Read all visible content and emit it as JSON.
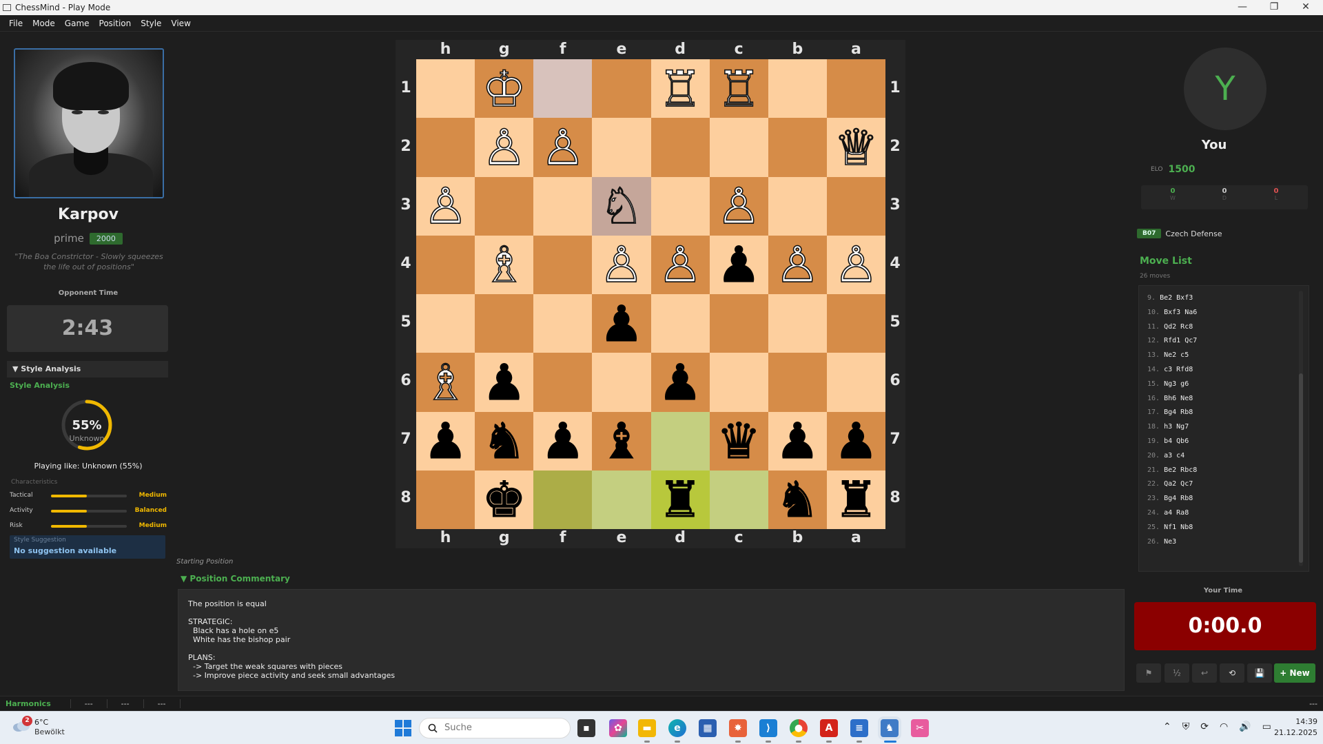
{
  "window": {
    "title": "ChessMind - Play Mode"
  },
  "menu": [
    "File",
    "Mode",
    "Game",
    "Position",
    "Style",
    "View"
  ],
  "opponent": {
    "name": "Karpov",
    "style": "prime",
    "elo": "2000",
    "quote": "\"The Boa Constrictor - Slowly squeezes the life out of positions\"",
    "time_label": "Opponent Time",
    "clock": "2:43"
  },
  "style_analysis": {
    "header": "▼ Style Analysis",
    "title": "Style Analysis",
    "percent": "55%",
    "percent_value": 0.55,
    "sub": "Unknown",
    "playing_like": "Playing like: Unknown (55%)",
    "characteristics_label": "Characteristics",
    "characteristics": [
      {
        "name": "Tactical",
        "value": "Medium",
        "level": 0.47
      },
      {
        "name": "Activity",
        "value": "Balanced",
        "level": 0.47
      },
      {
        "name": "Risk",
        "value": "Medium",
        "level": 0.47
      }
    ],
    "suggestion_label": "Style Suggestion",
    "suggestion": "No suggestion available"
  },
  "board": {
    "files": [
      "h",
      "g",
      "f",
      "e",
      "d",
      "c",
      "b",
      "a"
    ],
    "ranks": [
      "1",
      "2",
      "3",
      "4",
      "5",
      "6",
      "7",
      "8"
    ],
    "colors": {
      "light": "#fdcf9e",
      "dark": "#d68c48"
    },
    "rows": [
      [
        "",
        "K",
        "",
        "",
        "R",
        "R",
        "",
        ""
      ],
      [
        "",
        "P",
        "P",
        "",
        "",
        "",
        "",
        "Q"
      ],
      [
        "P",
        "",
        "",
        "N",
        "",
        "P",
        "",
        ""
      ],
      [
        "",
        "B",
        "",
        "P",
        "P",
        "p",
        "P",
        "P"
      ],
      [
        "",
        "",
        "",
        "p",
        "",
        "",
        "",
        ""
      ],
      [
        "B",
        "p",
        "",
        "",
        "p",
        "",
        "",
        ""
      ],
      [
        "p",
        "n",
        "p",
        "b",
        "",
        "q",
        "p",
        "p"
      ],
      [
        "",
        "k",
        "",
        "",
        "r",
        "",
        "n",
        "r"
      ]
    ],
    "highlights": {
      "0-2": "#d8c2bc",
      "2-3": "#c5a69a",
      "6-4": "#c4cf80",
      "7-2": "#acad47",
      "7-3": "#c4cf80",
      "7-4": "#b8c83c",
      "7-5": "#c4cf80"
    }
  },
  "position": {
    "label": "Starting Position",
    "commentary_header": "▼ Position Commentary",
    "commentary": [
      "The position is equal",
      "",
      "STRATEGIC:",
      "  Black has a hole on e5",
      "  White has the bishop pair",
      "",
      "PLANS:",
      "  -> Target the weak squares with pieces",
      "  -> Improve piece activity and seek small advantages"
    ]
  },
  "player": {
    "avatar_letter": "Y",
    "name": "You",
    "elo_label": "ELO",
    "elo": "1500",
    "wdl": [
      {
        "value": "0",
        "label": "W",
        "color": "#4caf50"
      },
      {
        "value": "0",
        "label": "D",
        "color": "#cccccc"
      },
      {
        "value": "0",
        "label": "L",
        "color": "#e05252"
      }
    ],
    "eco_code": "B07",
    "opening": "Czech Defense",
    "time_label": "Your Time",
    "clock": "0:00.0"
  },
  "movelist": {
    "title": "Move List",
    "count": "26 moves",
    "moves": [
      {
        "n": "9.",
        "m": "Be2 Bxf3"
      },
      {
        "n": "10.",
        "m": "Bxf3 Na6"
      },
      {
        "n": "11.",
        "m": "Qd2 Rc8"
      },
      {
        "n": "12.",
        "m": "Rfd1 Qc7"
      },
      {
        "n": "13.",
        "m": "Ne2 c5"
      },
      {
        "n": "14.",
        "m": "c3 Rfd8"
      },
      {
        "n": "15.",
        "m": "Ng3 g6"
      },
      {
        "n": "16.",
        "m": "Bh6 Ne8"
      },
      {
        "n": "17.",
        "m": "Bg4 Rb8"
      },
      {
        "n": "18.",
        "m": "h3 Ng7"
      },
      {
        "n": "19.",
        "m": "b4 Qb6"
      },
      {
        "n": "20.",
        "m": "a3 c4"
      },
      {
        "n": "21.",
        "m": "Be2 Rbc8"
      },
      {
        "n": "22.",
        "m": "Qa2 Qc7"
      },
      {
        "n": "23.",
        "m": "Bg4 Rb8"
      },
      {
        "n": "24.",
        "m": "a4 Ra8"
      },
      {
        "n": "25.",
        "m": "Nf1 Nb8"
      },
      {
        "n": "26.",
        "m": "Ne3"
      }
    ]
  },
  "controls": {
    "resign": "⚑",
    "draw": "½",
    "undo": "↩",
    "flip": "⟲",
    "save": "💾",
    "new": "+ New"
  },
  "status": {
    "main": "Harmonics",
    "fields": [
      "---",
      "---",
      "---"
    ],
    "right": "---"
  },
  "taskbar": {
    "weather_badge": "2",
    "temperature": "6°C",
    "condition": "Bewölkt",
    "search_placeholder": "Suche",
    "time": "14:39",
    "date": "21.12.2025"
  }
}
